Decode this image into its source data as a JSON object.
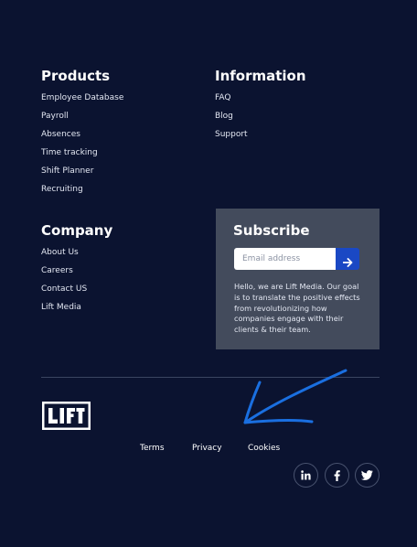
{
  "columns": {
    "products": {
      "title": "Products",
      "items": [
        "Employee Database",
        "Payroll",
        "Absences",
        "Time tracking",
        "Shift Planner",
        "Recruiting"
      ]
    },
    "information": {
      "title": "Information",
      "items": [
        "FAQ",
        "Blog",
        "Support"
      ]
    },
    "company": {
      "title": "Company",
      "items": [
        "About Us",
        "Careers",
        "Contact US",
        "Lift Media"
      ]
    }
  },
  "subscribe": {
    "title": "Subscribe",
    "email_placeholder": "Email address",
    "submit_icon": "arrow-right-icon",
    "about_text": "Hello, we are Lift Media. Our goal is to translate the positive effects from revolutionizing how companies engage with their clients & their team."
  },
  "logo": {
    "text": "LIFT"
  },
  "legal": {
    "terms": "Terms",
    "privacy": "Privacy",
    "cookies": "Cookies"
  },
  "social": [
    "linkedin-icon",
    "facebook-icon",
    "twitter-icon"
  ],
  "colors": {
    "background": "#0b1330",
    "subscribe_panel": "#434b5c",
    "accent_button": "#1a48c4",
    "annotation_arrow": "#1a6fe0"
  }
}
